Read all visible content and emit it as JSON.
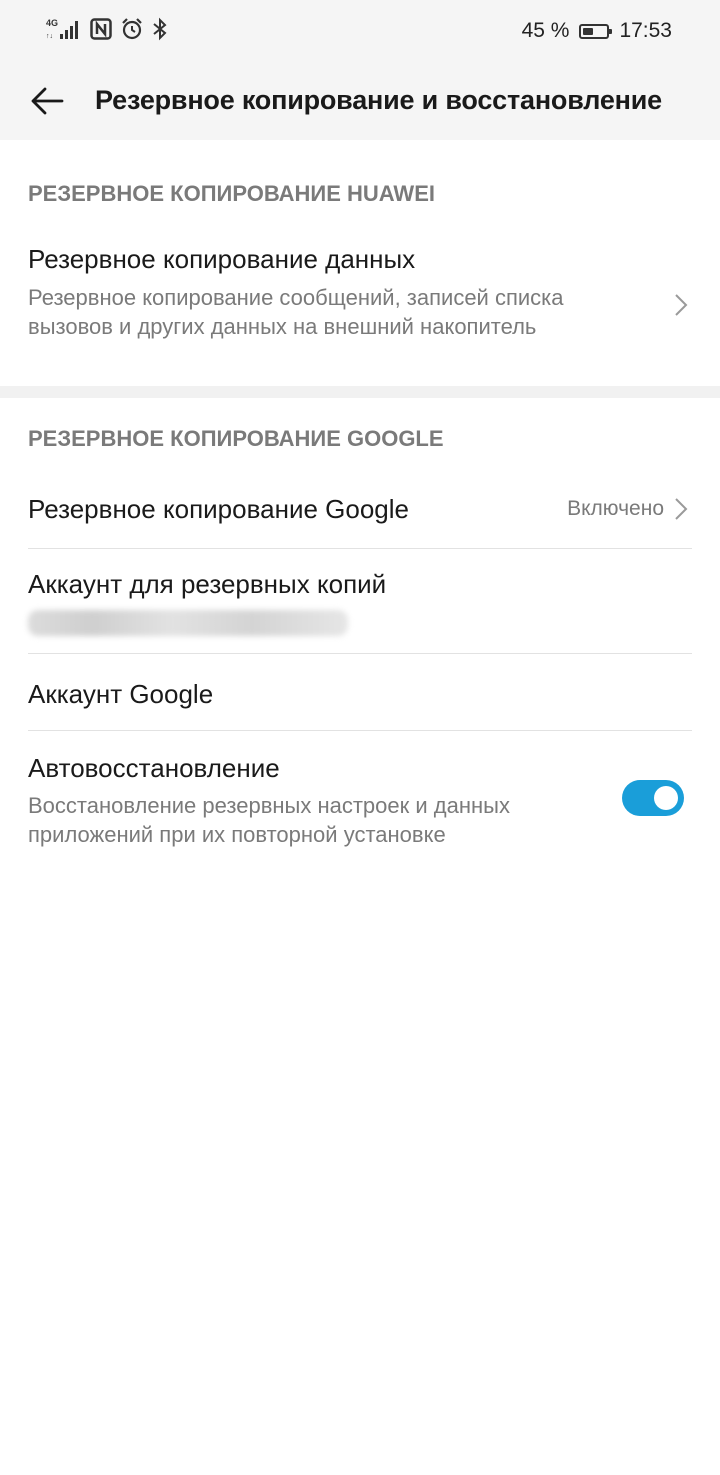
{
  "status_bar": {
    "network_type": "4G",
    "battery_percent": "45 %",
    "battery_level": 0.45,
    "time": "17:53",
    "icons": [
      "signal-icon",
      "nfc-icon",
      "alarm-icon",
      "bluetooth-icon",
      "battery-icon"
    ]
  },
  "toolbar": {
    "title": "Резервное копирование и восстановление"
  },
  "sections": {
    "huawei": {
      "header": "РЕЗЕРВНОЕ КОПИРОВАНИЕ HUAWEI",
      "items": [
        {
          "title": "Резервное копирование данных",
          "subtitle": "Резервное копирование сообщений, записей списка вызовов и других данных на внешний накопитель"
        }
      ]
    },
    "google": {
      "header": "РЕЗЕРВНОЕ КОПИРОВАНИЕ GOOGLE",
      "items": [
        {
          "title": "Резервное копирование Google",
          "value": "Включено"
        },
        {
          "title": "Аккаунт для резервных копий",
          "value": ""
        },
        {
          "title": "Аккаунт Google"
        },
        {
          "title": "Автовосстановление",
          "subtitle": "Восстановление резервных настроек и данных приложений при их повторной установке",
          "toggle_on": true
        }
      ]
    }
  },
  "colors": {
    "accent": "#1a9ed9",
    "header_bg": "#f5f5f5",
    "secondary_text": "#7a7a7a"
  }
}
